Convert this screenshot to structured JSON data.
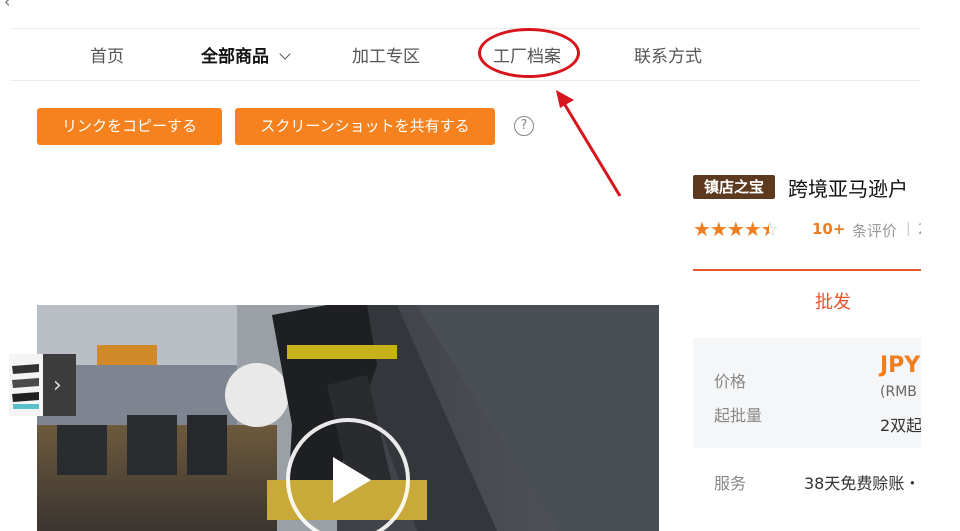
{
  "nav": {
    "back_icon": "chevron-left-icon",
    "items": [
      "首页",
      "全部商品",
      "加工专区",
      "工厂档案",
      "联系方式"
    ],
    "active_index": 1
  },
  "annotation": {
    "color": "#d8141c"
  },
  "actions": {
    "copy_link": "リンクをコピーする",
    "share_screenshot": "スクリーンショットを共有する",
    "help_icon": "question-circle-icon"
  },
  "product": {
    "badge": "镇店之宝",
    "title": "跨境亚马逊户",
    "rating_stars": 4.5,
    "review_count": "10+",
    "review_label": "条评价",
    "review_sep": "|",
    "review_extra": "2",
    "tab": "批发",
    "price_label": "价格",
    "price_value": "JPY",
    "price_rmb": "(RMB",
    "moq_label": "起批量",
    "moq_value": "2双起",
    "service_label": "服务",
    "service_value": "38天免费赊账・"
  },
  "colors": {
    "accent": "#f5821f",
    "brand_dark": "#5d3a1f",
    "tab_red": "#e8552b"
  }
}
